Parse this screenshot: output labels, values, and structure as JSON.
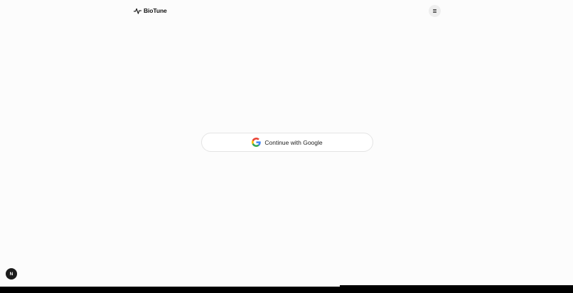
{
  "header": {
    "brand_name": "BioTune",
    "brand_icon": "pulse-icon",
    "menu_icon": "hamburger-icon"
  },
  "auth": {
    "google_button_label": "Continue with Google",
    "google_icon": "google-icon"
  },
  "dev_badge": {
    "letter": "N"
  },
  "colors": {
    "background": "#fcfcfc",
    "text": "#111111",
    "menu_button_bg": "#eeeeee",
    "button_border": "#e4e4e4",
    "badge_bg": "#1c1c1c"
  }
}
